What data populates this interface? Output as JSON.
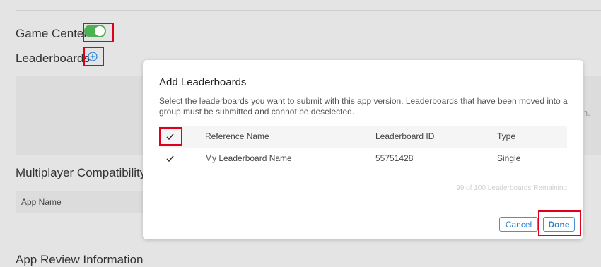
{
  "background": {
    "game_center_label": "Game Center",
    "game_center_enabled": true,
    "leaderboards_label": "Leaderboards",
    "multiplayer_label": "Multiplayer Compatibility",
    "app_name_header": "App Name",
    "panel_cut_text": "n.",
    "bottom_cut_title": "App Review Information"
  },
  "modal": {
    "title": "Add Leaderboards",
    "description": "Select the leaderboards you want to submit with this app version. Leaderboards that have been moved into a group must be submitted and cannot be deselected.",
    "columns": {
      "reference_name": "Reference Name",
      "leaderboard_id": "Leaderboard ID",
      "type": "Type"
    },
    "select_all_checked": true,
    "rows": [
      {
        "checked": true,
        "reference_name": "My Leaderboard Name",
        "leaderboard_id": "55751428",
        "type": "Single"
      }
    ],
    "remaining_text": "99 of 100 Leaderboards Remaining",
    "cancel_label": "Cancel",
    "done_label": "Done"
  },
  "colors": {
    "accent": "#2a7fd4",
    "toggle_on": "#4cb150",
    "highlight_box": "#e0001b"
  },
  "icons": {
    "add": "plus-circle-icon",
    "check": "checkmark-icon"
  }
}
